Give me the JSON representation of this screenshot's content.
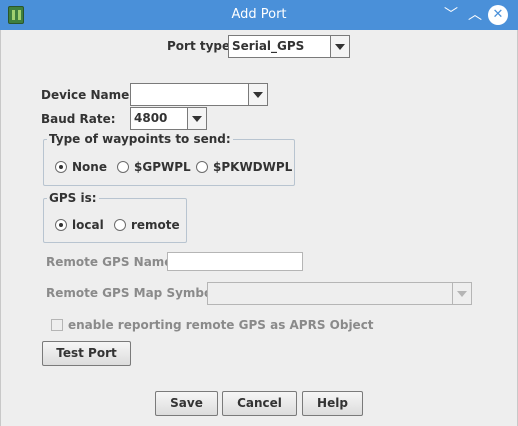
{
  "window": {
    "title": "Add Port",
    "minimize_glyph": "﹀",
    "maximize_glyph": "︿",
    "close_glyph": "✕"
  },
  "port_type": {
    "label": "Port type",
    "value": "Serial_GPS"
  },
  "device_name": {
    "label": "Device Name:",
    "value": ""
  },
  "baud_rate": {
    "label": "Baud Rate:",
    "value": "4800"
  },
  "waypoints": {
    "title": "Type of waypoints to send:",
    "options": [
      {
        "label": "None",
        "selected": true
      },
      {
        "label": "$GPWPL",
        "selected": false
      },
      {
        "label": "$PKWDWPL",
        "selected": false
      }
    ]
  },
  "gps_is": {
    "title": "GPS is:",
    "options": [
      {
        "label": "local",
        "selected": true
      },
      {
        "label": "remote",
        "selected": false
      }
    ]
  },
  "remote_gps_name": {
    "label": "Remote GPS Name:",
    "value": ""
  },
  "remote_gps_map_symbol": {
    "label": "Remote GPS Map Symbol:",
    "value": ""
  },
  "report_checkbox": {
    "label": "enable reporting remote GPS as APRS Object",
    "checked": false
  },
  "buttons": {
    "test_port": "Test Port",
    "save": "Save",
    "cancel": "Cancel",
    "help": "Help"
  },
  "colors": {
    "titlebar": "#4a90d9",
    "background": "#eeeeee",
    "disabled_text": "#8a8a8a"
  }
}
